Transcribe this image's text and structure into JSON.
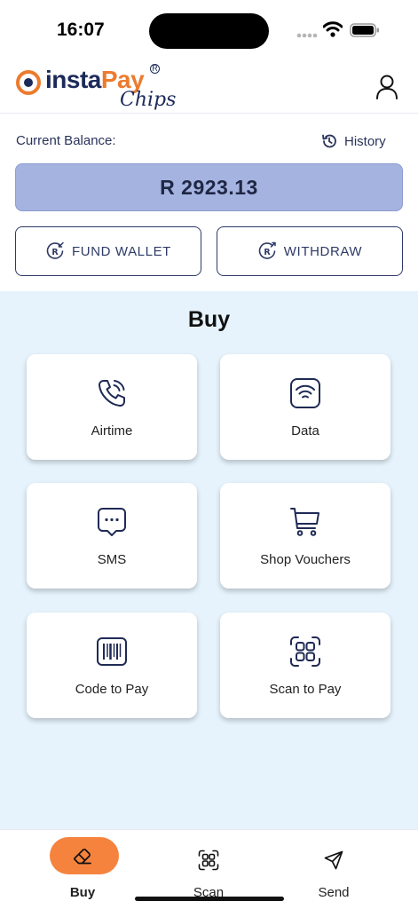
{
  "status_bar": {
    "time": "16:07"
  },
  "header": {
    "logo_text_1": "insta",
    "logo_text_2": "Pay",
    "logo_sub": "Chips",
    "logo_reg": "R",
    "profile_icon": "user-icon"
  },
  "balance": {
    "label": "Current Balance:",
    "history_label": "History",
    "history_icon": "history-icon",
    "amount": "R 2923.13"
  },
  "actions": {
    "fund_wallet": "FUND WALLET",
    "withdraw": "WITHDRAW"
  },
  "buy": {
    "title": "Buy",
    "tiles": [
      {
        "label": "Airtime",
        "icon": "phone-icon"
      },
      {
        "label": "Data",
        "icon": "wifi-icon"
      },
      {
        "label": "SMS",
        "icon": "chat-icon"
      },
      {
        "label": "Shop Vouchers",
        "icon": "cart-icon"
      },
      {
        "label": "Code to Pay",
        "icon": "barcode-icon"
      },
      {
        "label": "Scan to Pay",
        "icon": "qr-scan-icon"
      }
    ]
  },
  "nav": {
    "items": [
      {
        "label": "Buy",
        "icon": "eraser-icon",
        "active": true
      },
      {
        "label": "Scan",
        "icon": "qr-scan-icon",
        "active": false
      },
      {
        "label": "Send",
        "icon": "send-icon",
        "active": false
      }
    ]
  },
  "colors": {
    "brand_navy": "#1c2a5a",
    "brand_orange": "#ec7b2d",
    "balance_bg": "#a5b3e0",
    "panel_bg": "#e6f3fc",
    "nav_active": "#f5833e"
  }
}
